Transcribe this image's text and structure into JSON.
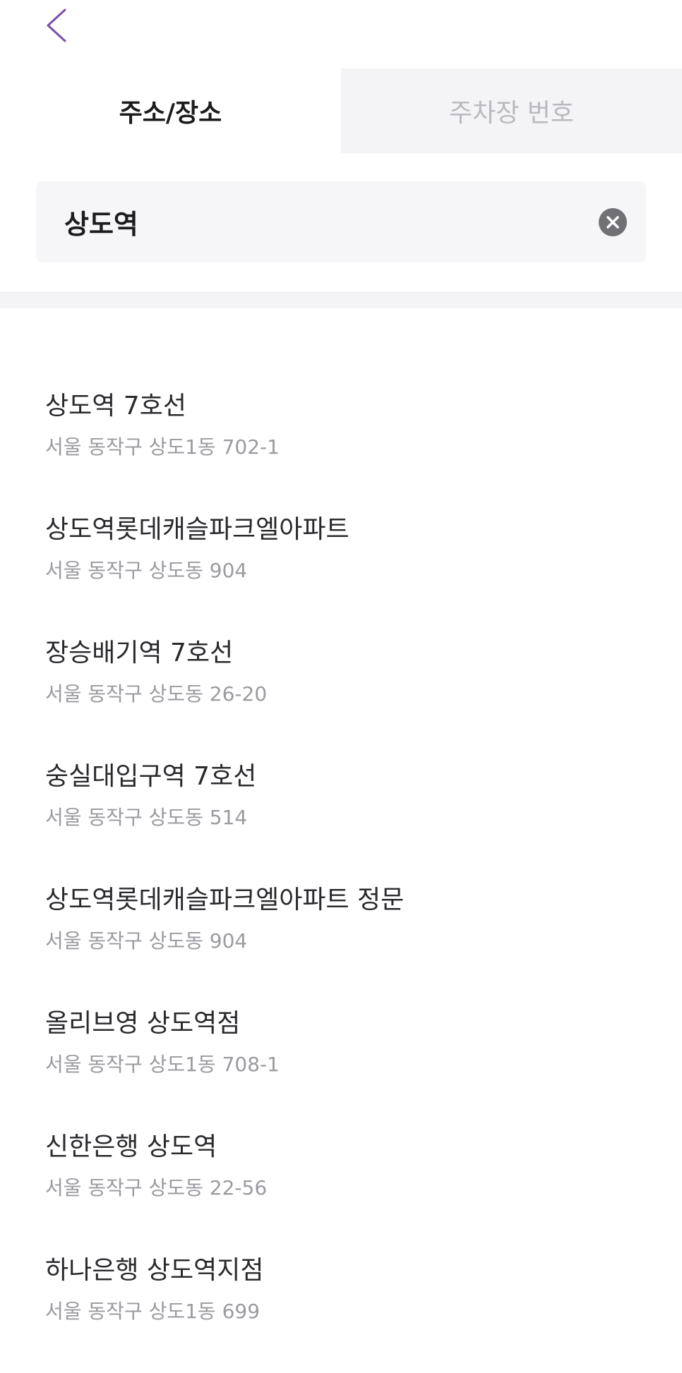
{
  "nav": {
    "back_icon": "chevron-left-icon",
    "accent_color": "#7b4fa8"
  },
  "tabs": [
    {
      "label": "주소/장소",
      "active": true
    },
    {
      "label": "주차장 번호",
      "active": false
    }
  ],
  "search": {
    "value": "상도역",
    "clear_icon": "clear-circle-x-icon"
  },
  "results": [
    {
      "name": "상도역 7호선",
      "address": "서울 동작구 상도1동 702-1"
    },
    {
      "name": "상도역롯데캐슬파크엘아파트",
      "address": "서울 동작구 상도동 904"
    },
    {
      "name": "장승배기역 7호선",
      "address": "서울 동작구 상도동 26-20"
    },
    {
      "name": "숭실대입구역 7호선",
      "address": "서울 동작구 상도동 514"
    },
    {
      "name": "상도역롯데캐슬파크엘아파트 정문",
      "address": "서울 동작구 상도동 904"
    },
    {
      "name": "올리브영 상도역점",
      "address": "서울 동작구 상도1동 708-1"
    },
    {
      "name": "신한은행 상도역",
      "address": "서울 동작구 상도동 22-56"
    },
    {
      "name": "하나은행 상도역지점",
      "address": "서울 동작구 상도1동 699"
    }
  ]
}
